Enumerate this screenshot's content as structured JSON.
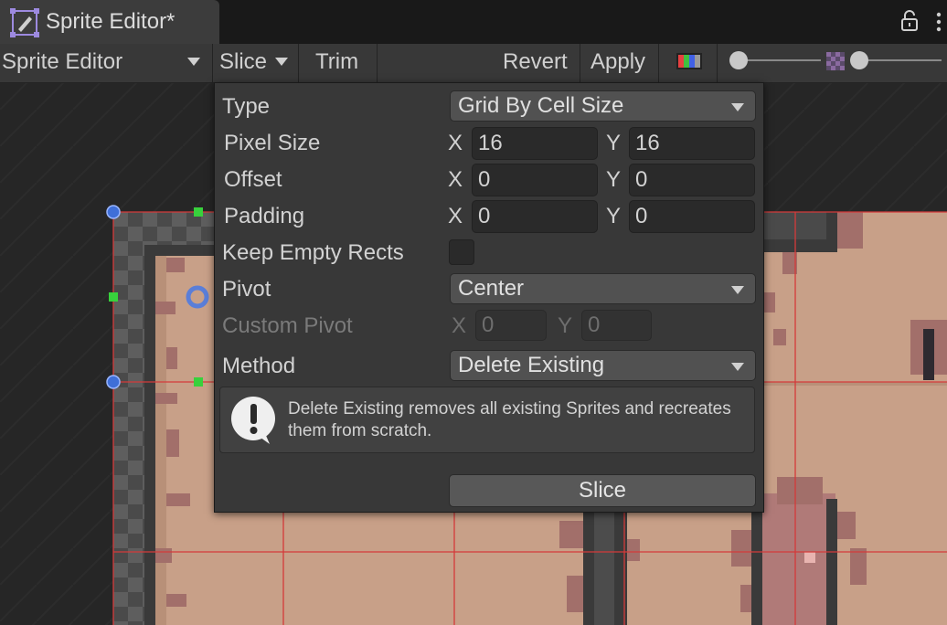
{
  "tab": {
    "title": "Sprite Editor*",
    "icon": "sprite-editor-icon"
  },
  "toolbar": {
    "mode": "Sprite Editor",
    "slice": "Slice",
    "trim": "Trim",
    "revert": "Revert",
    "apply": "Apply"
  },
  "popup": {
    "type_label": "Type",
    "type_value": "Grid By Cell Size",
    "pixel_size_label": "Pixel Size",
    "pixel_size_x": "16",
    "pixel_size_y": "16",
    "offset_label": "Offset",
    "offset_x": "0",
    "offset_y": "0",
    "padding_label": "Padding",
    "padding_x": "0",
    "padding_y": "0",
    "keep_empty_label": "Keep Empty Rects",
    "pivot_label": "Pivot",
    "pivot_value": "Center",
    "custom_pivot_label": "Custom Pivot",
    "custom_pivot_x": "0",
    "custom_pivot_y": "0",
    "method_label": "Method",
    "method_value": "Delete Existing",
    "help_text": "Delete Existing removes all existing Sprites and recreates them from scratch.",
    "slice_button": "Slice",
    "x_label": "X",
    "y_label": "Y"
  },
  "colors": {
    "accent_handle": "#3f6fd8",
    "selection_green": "#38d13c",
    "grid_line": "#d43a3a",
    "sprite_tan": "#c8a088"
  }
}
